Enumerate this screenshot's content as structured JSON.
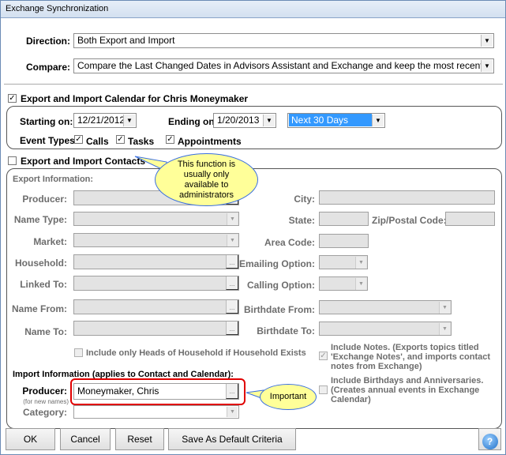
{
  "window": {
    "title": "Exchange Synchronization"
  },
  "direction": {
    "label": "Direction:",
    "value": "Both Export and Import"
  },
  "compare": {
    "label": "Compare:",
    "value": "Compare the Last Changed Dates in Advisors Assistant and Exchange and keep the most recent"
  },
  "calendar": {
    "checkbox_label": "Export and Import Calendar for Chris Moneymaker",
    "checked": true,
    "starting_label": "Starting on:",
    "starting_value": "12/21/2012",
    "ending_label": "Ending on:",
    "ending_value": "1/20/2013",
    "range_value": "Next 30 Days",
    "event_types_label": "Event Types:",
    "events": [
      {
        "label": "Calls",
        "checked": true
      },
      {
        "label": "Tasks",
        "checked": true
      },
      {
        "label": "Appointments",
        "checked": true
      }
    ]
  },
  "contacts": {
    "checkbox_label": "Export and Import Contacts",
    "checked": false,
    "export_heading": "Export Information:",
    "left_fields": [
      "Producer:",
      "Name Type:",
      "Market:",
      "Household:",
      "Linked To:",
      "Name From:",
      "Name To:"
    ],
    "city": "City:",
    "state": "State:",
    "zip": "Zip/Postal Code:",
    "area_code": "Area Code:",
    "emailing": "Emailing Option:",
    "calling": "Calling Option:",
    "birth_from": "Birthdate From:",
    "birth_to": "Birthdate To:",
    "heads_label": "Include only Heads of Household if Household Exists",
    "notes_label": "Include Notes.  (Exports topics titled 'Exchange Notes', and imports contact notes from Exchange)",
    "birthdays_label": "Include Birthdays and Anniversaries. (Creates annual events in Exchange Calendar)",
    "import_heading": "Import Information (applies to Contact and Calendar):",
    "import_producer_label": "Producer:",
    "import_producer_note": "(for new names)",
    "import_producer_value": "Moneymaker, Chris",
    "category_label": "Category:"
  },
  "callouts": {
    "admin": "This function is usually only available to administrators",
    "important": "Important"
  },
  "buttons": {
    "ok": "OK",
    "cancel": "Cancel",
    "reset": "Reset",
    "save_default": "Save As Default Criteria",
    "help": "?"
  },
  "colors": {
    "selection": "#3399ff",
    "highlight": "#e00000",
    "callout": "#ffff99"
  }
}
